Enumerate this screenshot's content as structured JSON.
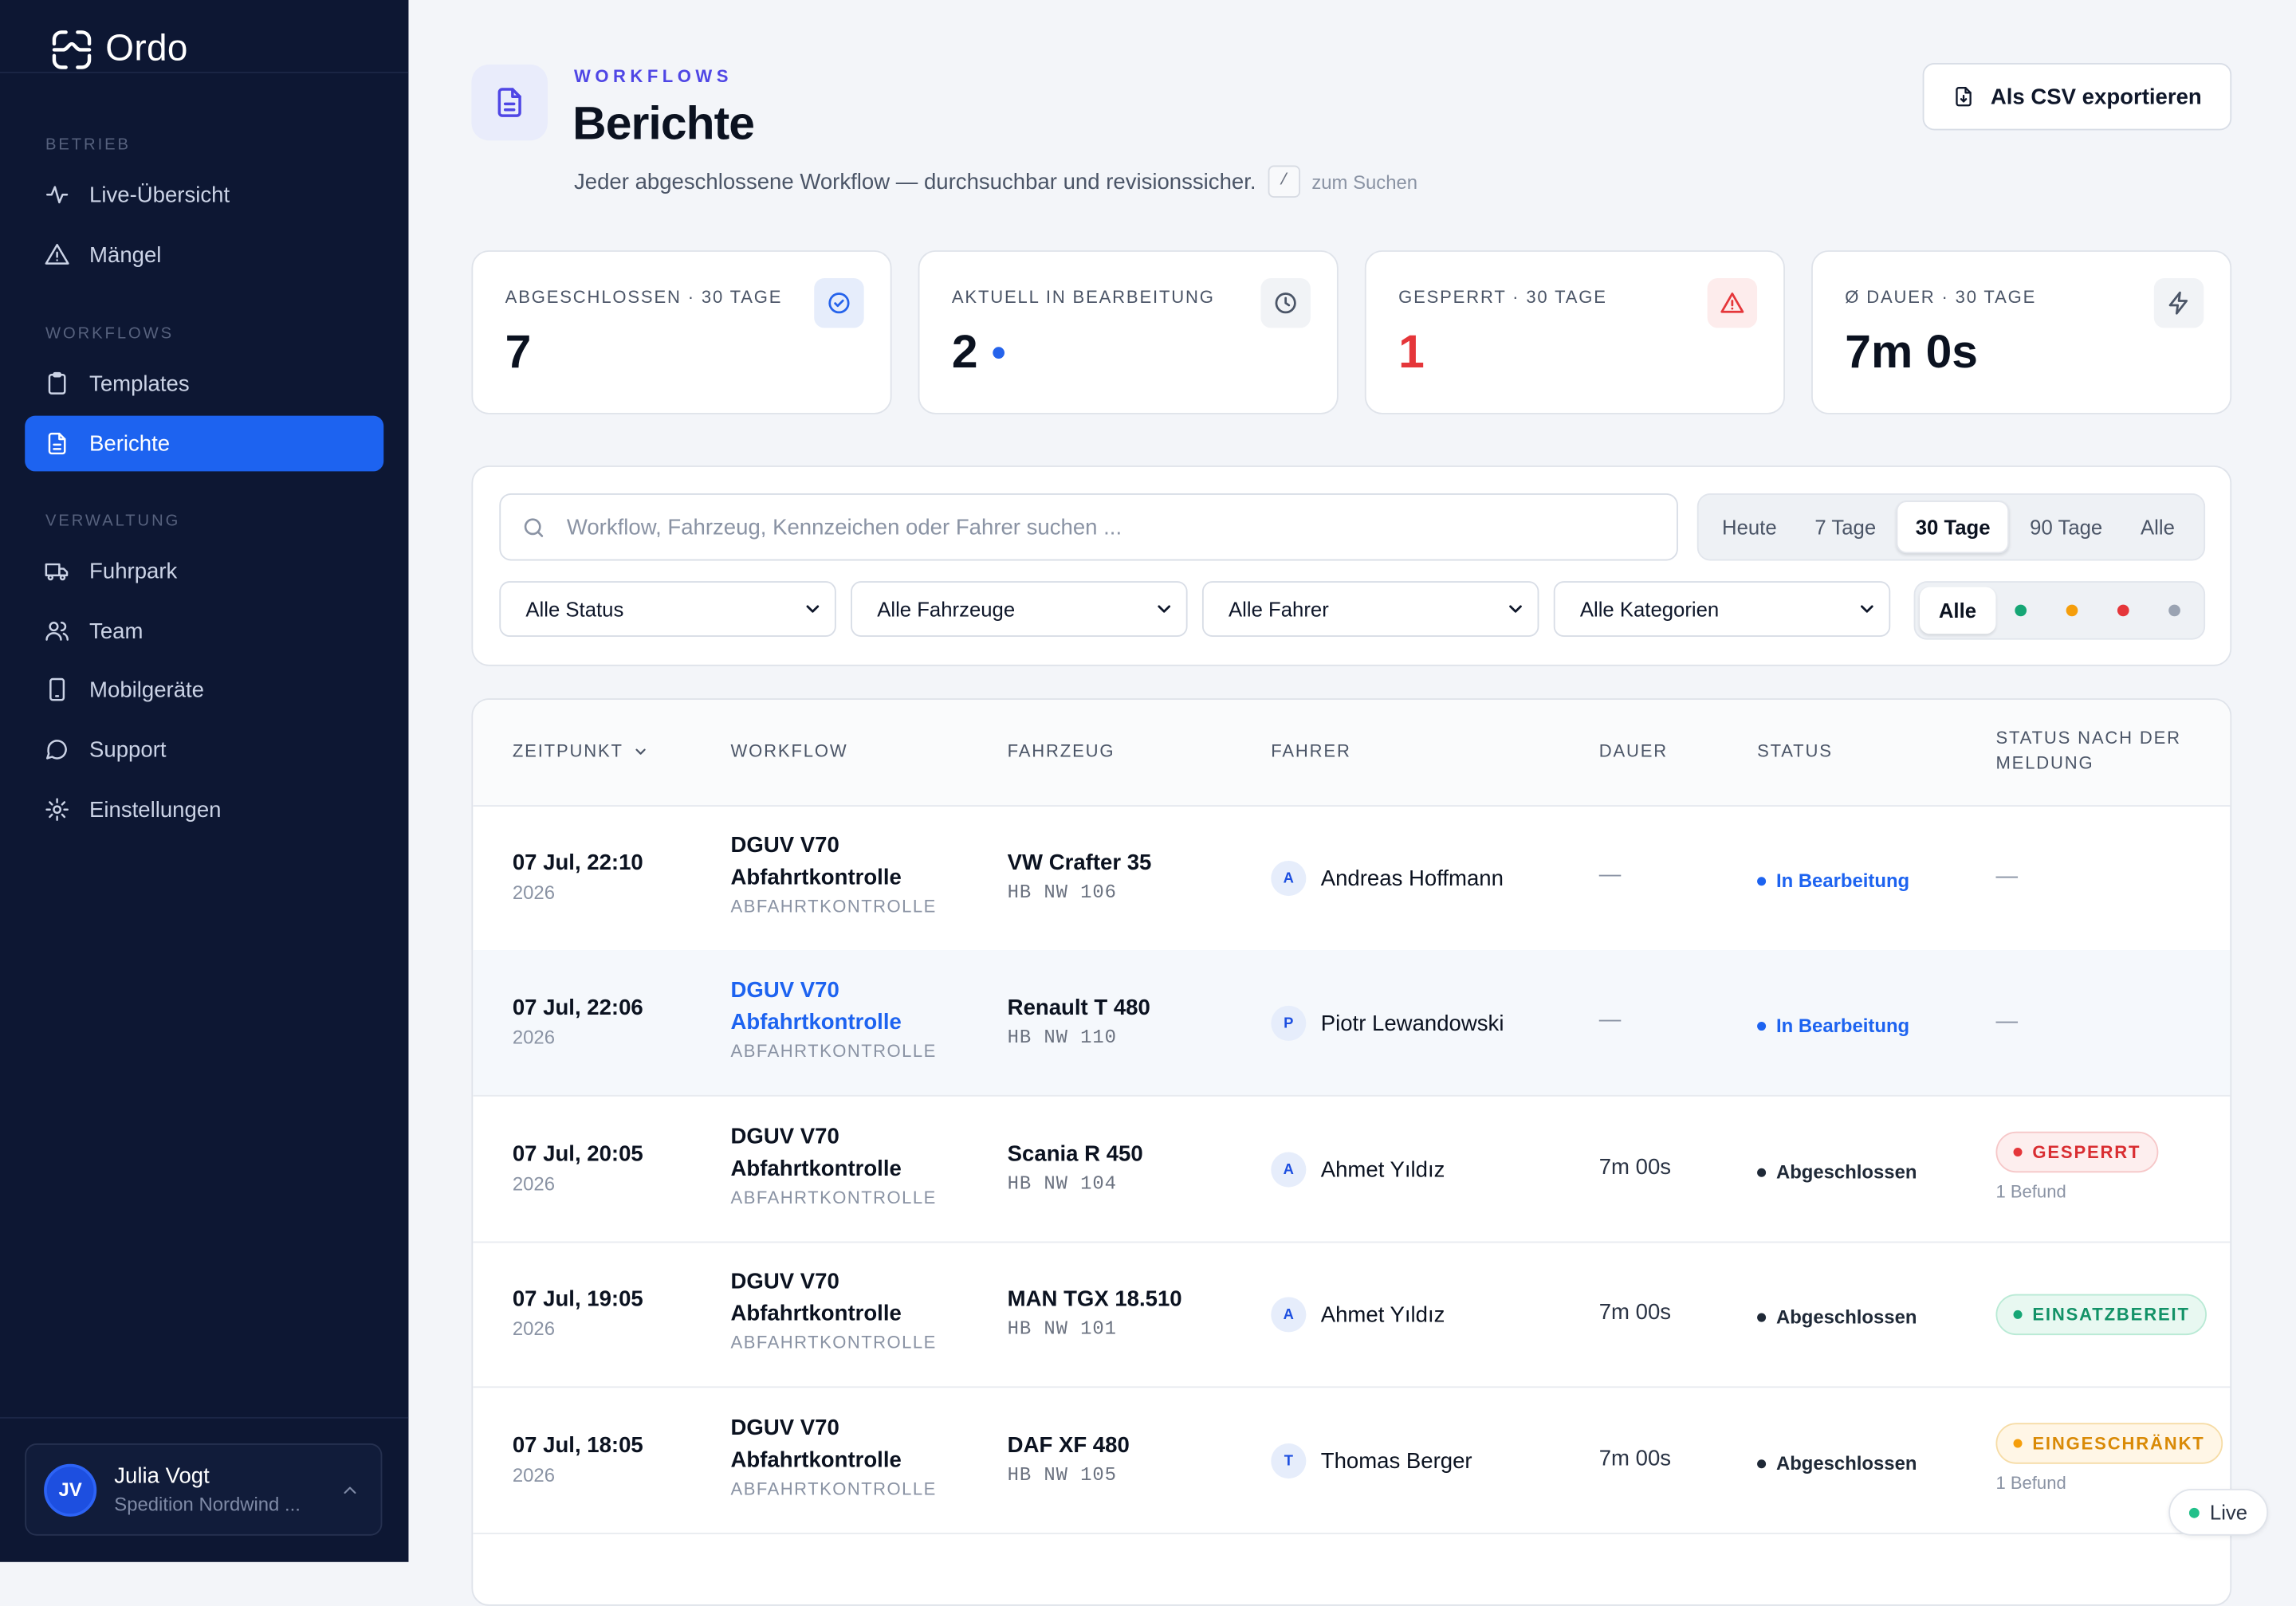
{
  "app": {
    "name": "Ordo"
  },
  "sidebar": {
    "sections": [
      {
        "label": "BETRIEB",
        "items": [
          {
            "label": "Live-Übersicht",
            "icon": "activity-icon"
          },
          {
            "label": "Mängel",
            "icon": "warning-triangle-icon"
          }
        ]
      },
      {
        "label": "WORKFLOWS",
        "items": [
          {
            "label": "Templates",
            "icon": "clipboard-icon"
          },
          {
            "label": "Berichte",
            "icon": "document-icon",
            "active": true
          }
        ]
      },
      {
        "label": "VERWALTUNG",
        "items": [
          {
            "label": "Fuhrpark",
            "icon": "truck-icon"
          },
          {
            "label": "Team",
            "icon": "users-icon"
          },
          {
            "label": "Mobilgeräte",
            "icon": "phone-icon"
          },
          {
            "label": "Support",
            "icon": "chat-bubble-icon"
          },
          {
            "label": "Einstellungen",
            "icon": "gear-icon"
          }
        ]
      }
    ],
    "user": {
      "initials": "JV",
      "name": "Julia Vogt",
      "org": "Spedition Nordwind ..."
    }
  },
  "header": {
    "eyebrow": "WORKFLOWS",
    "title": "Berichte",
    "subtitle": "Jeder abgeschlossene Workflow — durchsuchbar und revisionssicher.",
    "shortcut_key": "/",
    "shortcut_hint": "zum Suchen",
    "export_label": "Als CSV exportieren"
  },
  "kpis": [
    {
      "label": "ABGESCHLOSSEN · 30 TAGE",
      "value": "7",
      "icon": "check-circle-icon",
      "color": "#2563eb"
    },
    {
      "label": "AKTUELL IN BEARBEITUNG",
      "value": "2",
      "icon": "clock-icon",
      "color": "#4b5567"
    },
    {
      "label": "GESPERRT · 30 TAGE",
      "value": "1",
      "icon": "warning-triangle-icon",
      "color": "#e5363a"
    },
    {
      "label": "Ø DAUER · 30 TAGE",
      "value": "7m 0s",
      "icon": "lightning-icon",
      "color": "#4b5567"
    }
  ],
  "filters": {
    "search_placeholder": "Workflow, Fahrzeug, Kennzeichen oder Fahrer suchen ...",
    "ranges": [
      "Heute",
      "7 Tage",
      "30 Tage",
      "90 Tage",
      "Alle"
    ],
    "active_range": "30 Tage",
    "selects": [
      "Alle Status",
      "Alle Fahrzeuge",
      "Alle Fahrer",
      "Alle Kategorien"
    ],
    "dot_filter_all": "Alle",
    "dot_colors": [
      "#16a675",
      "#f59e0b",
      "#e5363a",
      "#9aa3b2"
    ]
  },
  "table": {
    "columns": [
      "ZEITPUNKT",
      "WORKFLOW",
      "FAHRZEUG",
      "FAHRER",
      "DAUER",
      "STATUS",
      "STATUS NACH DER MELDUNG"
    ],
    "rows": [
      {
        "time": "07 Jul, 22:10",
        "year": "2026",
        "workflow": "DGUV V70 Abfahrtkontrolle",
        "category": "ABFAHRTKONTROLLE",
        "vehicle": "VW Crafter 35",
        "plate": "HB NW 106",
        "driver_initial": "A",
        "driver": "Andreas Hoffmann",
        "duration": "—",
        "status": "In Bearbeitung",
        "result": "—"
      },
      {
        "time": "07 Jul, 22:06",
        "year": "2026",
        "workflow": "DGUV V70 Abfahrtkontrolle",
        "category": "ABFAHRTKONTROLLE",
        "vehicle": "Renault T 480",
        "plate": "HB NW 110",
        "driver_initial": "P",
        "driver": "Piotr Lewandowski",
        "duration": "—",
        "status": "In Bearbeitung",
        "result": "—"
      },
      {
        "time": "07 Jul, 20:05",
        "year": "2026",
        "workflow": "DGUV V70 Abfahrtkontrolle",
        "category": "ABFAHRTKONTROLLE",
        "vehicle": "Scania R 450",
        "plate": "HB NW 104",
        "driver_initial": "A",
        "driver": "Ahmet Yıldız",
        "duration": "7m 00s",
        "status": "Abgeschlossen",
        "result": "GESPERRT",
        "finding": "1 Befund"
      },
      {
        "time": "07 Jul, 19:05",
        "year": "2026",
        "workflow": "DGUV V70 Abfahrtkontrolle",
        "category": "ABFAHRTKONTROLLE",
        "vehicle": "MAN TGX 18.510",
        "plate": "HB NW 101",
        "driver_initial": "A",
        "driver": "Ahmet Yıldız",
        "duration": "7m 00s",
        "status": "Abgeschlossen",
        "result": "EINSATZBEREIT"
      },
      {
        "time": "07 Jul, 18:05",
        "year": "2026",
        "workflow": "DGUV V70 Abfahrtkontrolle",
        "category": "ABFAHRTKONTROLLE",
        "vehicle": "DAF XF 480",
        "plate": "HB NW 105",
        "driver_initial": "T",
        "driver": "Thomas Berger",
        "duration": "7m 00s",
        "status": "Abgeschlossen",
        "result": "EINGESCHRÄNKT",
        "finding": "1 Befund"
      }
    ]
  },
  "live_label": "Live"
}
